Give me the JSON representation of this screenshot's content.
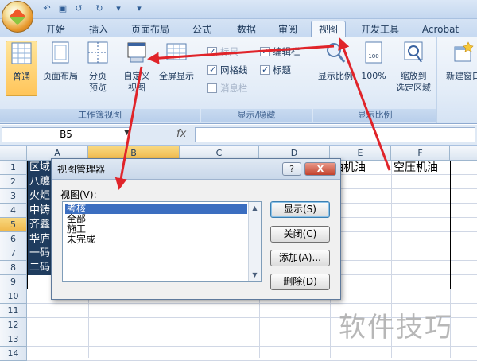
{
  "ribbon": {
    "tabs": [
      {
        "label": "开始",
        "active": false
      },
      {
        "label": "插入",
        "active": false
      },
      {
        "label": "页面布局",
        "active": false
      },
      {
        "label": "公式",
        "active": false
      },
      {
        "label": "数据",
        "active": false
      },
      {
        "label": "审阅",
        "active": false
      },
      {
        "label": "视图",
        "active": true
      },
      {
        "label": "开发工具",
        "active": false
      },
      {
        "label": "Acrobat",
        "active": false
      }
    ],
    "workbook_views": {
      "label": "工作簿视图",
      "buttons": [
        {
          "label": "普通",
          "selected": true
        },
        {
          "label": "页面布局",
          "selected": false
        },
        {
          "label_line1": "分页",
          "label_line2": "预览",
          "selected": false
        },
        {
          "label_line1": "自定义",
          "label_line2": "视图",
          "selected": false
        },
        {
          "label": "全屏显示",
          "selected": false
        }
      ]
    },
    "show_hide": {
      "label": "显示/隐藏",
      "checkboxes": [
        {
          "label": "标尺",
          "checked": true,
          "disabled": true
        },
        {
          "label": "网格线",
          "checked": true,
          "disabled": false
        },
        {
          "label": "消息栏",
          "checked": false,
          "disabled": true
        },
        {
          "label": "编辑栏",
          "checked": true,
          "disabled": false
        },
        {
          "label": "标题",
          "checked": true,
          "disabled": false
        }
      ]
    },
    "zoom": {
      "label": "显示比例",
      "buttons": [
        {
          "label": "显示比例"
        },
        {
          "label": "100%"
        },
        {
          "label_line1": "缩放到",
          "label_line2": "选定区域"
        }
      ]
    },
    "window": {
      "buttons": [
        {
          "label": "新建窗口"
        }
      ]
    }
  },
  "formula_bar": {
    "name_box": "B5",
    "fx": "fx",
    "formula": ""
  },
  "sheet": {
    "columns": [
      "A",
      "B",
      "C",
      "D",
      "E",
      "F"
    ],
    "rows": [
      "1",
      "2",
      "3",
      "4",
      "5",
      "6",
      "7",
      "8",
      "9",
      "10",
      "11",
      "12",
      "13",
      "14"
    ],
    "selected_column": "B",
    "selected_row": "5",
    "column_a_cells": [
      "区域",
      "八躔",
      "火炬",
      "中铸",
      "齐鑫",
      "华庐",
      "一码",
      "二码"
    ],
    "e1": "油机油",
    "f1": "空压机油"
  },
  "dialog": {
    "title": "视图管理器",
    "help_label": "?",
    "close_label": "X",
    "list_label": "视图(V):",
    "views": [
      "考核",
      "全部",
      "施工",
      "未完成"
    ],
    "selected_view": "考核",
    "buttons": {
      "show": "显示(S)",
      "close": "关闭(C)",
      "add": "添加(A)...",
      "delete": "删除(D)"
    }
  },
  "watermark": "软件技巧",
  "colors": {
    "arrow": "#e0242a",
    "selection": "#3b6ec0",
    "header_selected": "#f0b84a"
  }
}
